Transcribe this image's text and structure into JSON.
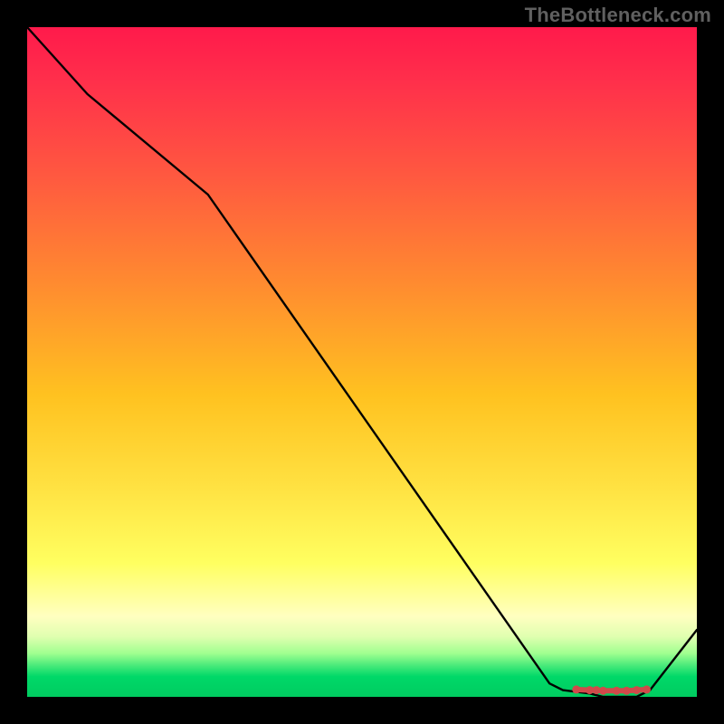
{
  "watermark": "TheBottleneck.com",
  "chart_data": {
    "type": "line",
    "title": "",
    "xlabel": "",
    "ylabel": "",
    "xlim": [
      0,
      100
    ],
    "ylim": [
      0,
      100
    ],
    "grid": false,
    "legend": false,
    "series": [
      {
        "name": "curve",
        "color": "#000000",
        "x": [
          0,
          9,
          27,
          78,
          80,
          84,
          86,
          91,
          93,
          100
        ],
        "values": [
          100,
          90,
          75,
          2,
          1,
          0.5,
          0,
          0,
          1,
          10
        ]
      }
    ],
    "markers": {
      "name": "highlight-band",
      "color": "#d04a4a",
      "x": [
        82,
        84,
        85,
        86,
        88,
        89.5,
        91,
        92.5
      ],
      "values": [
        1.1,
        1.0,
        1.0,
        0.9,
        0.9,
        0.9,
        1.0,
        1.1
      ]
    },
    "background_gradient": {
      "top": "#ff1a4b",
      "mid": "#ffe040",
      "bottom": "#00cc60"
    }
  }
}
